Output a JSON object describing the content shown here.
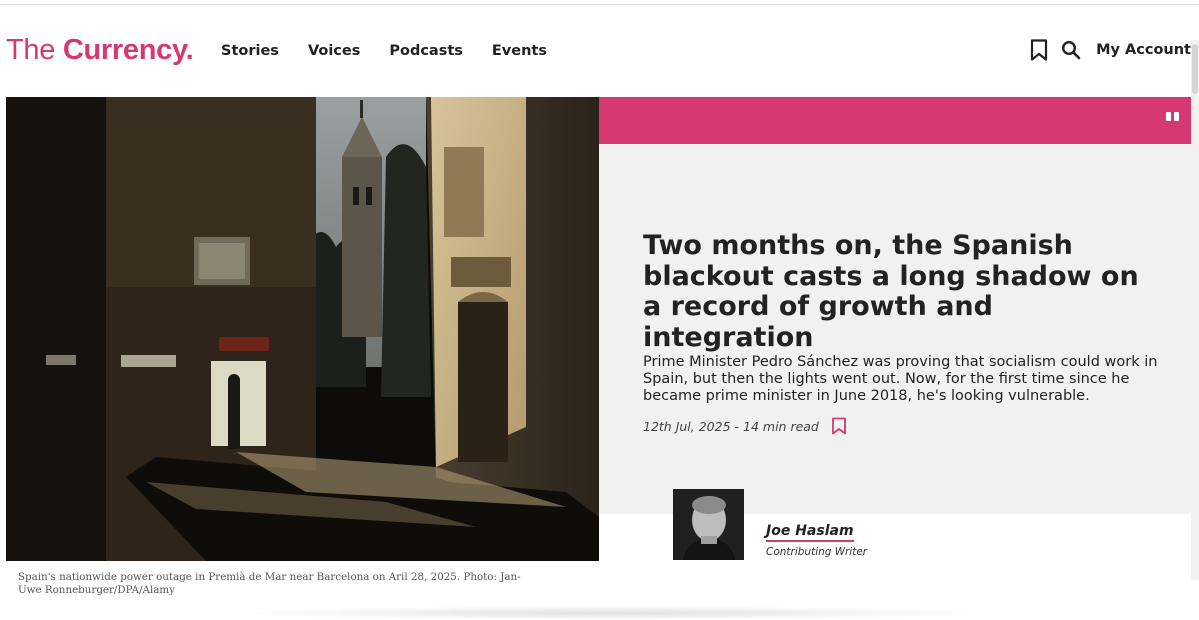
{
  "logo": {
    "part1": "The ",
    "part2": "Currency",
    "dot": "."
  },
  "nav": {
    "items": [
      "Stories",
      "Voices",
      "Podcasts",
      "Events"
    ]
  },
  "header": {
    "account_label": "My Account",
    "icons": [
      "bookmark-icon",
      "search-icon"
    ]
  },
  "article": {
    "headline": "Two months on, the Spanish blackout casts a long shadow on a record of growth and integration",
    "standfirst": "Prime Minister Pedro Sánchez was proving that socialism could work in Spain, but then the lights went out. Now, for the first time since he became prime minister in June 2018, he's looking vulnerable.",
    "date": "12th Jul, 2025",
    "read_time": "14 min read",
    "meta_separator": " - "
  },
  "image": {
    "caption": "Spain's nationwide power outage in Premià de Mar near Barcelona on Aril 28, 2025. Photo: Jan-Uwe Ronneburger/DPA/Alamy"
  },
  "author": {
    "name": "Joe Haslam",
    "role": "Contributing Writer"
  },
  "colors": {
    "brand": "#d63873",
    "panel": "#f1f1f1",
    "text": "#222222"
  }
}
